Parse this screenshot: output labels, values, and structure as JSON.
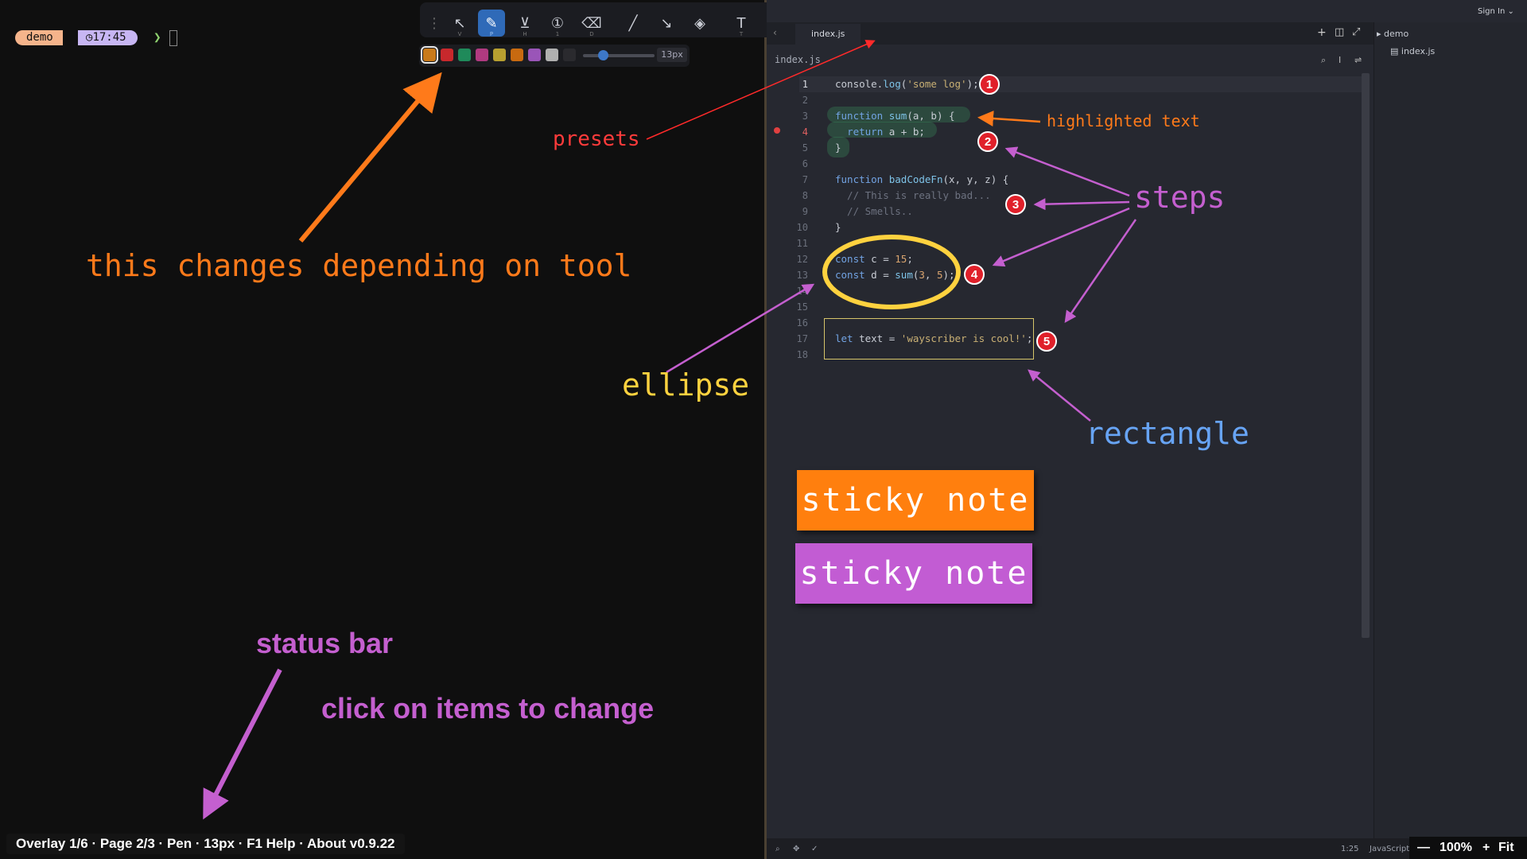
{
  "terminal": {
    "session_name": "demo",
    "clock": "17:45",
    "prompt_symbol": "❯"
  },
  "toolbar": {
    "tools": [
      {
        "name": "select-tool",
        "icon": "cursor-icon",
        "key": "V"
      },
      {
        "name": "pen-tool",
        "icon": "pen-icon",
        "key": "P",
        "active": true
      },
      {
        "name": "marker-tool",
        "icon": "marker-icon",
        "key": "H"
      },
      {
        "name": "step-tool",
        "icon": "step-marker-icon",
        "key": "1"
      },
      {
        "name": "eraser-tool",
        "icon": "eraser-icon",
        "key": "D"
      },
      {
        "name": "line-tool",
        "icon": "line-icon",
        "key": ""
      },
      {
        "name": "arrow-tool",
        "icon": "arrow-icon",
        "key": ""
      },
      {
        "name": "shapes-tool",
        "icon": "shapes-icon",
        "key": ""
      },
      {
        "name": "text-tool",
        "icon": "text-icon",
        "key": "T"
      }
    ],
    "preset_number": "5",
    "size_readout": "13px"
  },
  "color_presets": [
    "#c87a1a",
    "#c8282c",
    "#1f8a5a",
    "#b03a80",
    "#b8a030",
    "#c86a10",
    "#9a55b8",
    "#b0b0b0",
    "#2a2a2e"
  ],
  "editor": {
    "sign_in": "Sign In",
    "tab_label": "index.js",
    "breadcrumb": "index.js",
    "explorer_folder": "demo",
    "explorer_file": "index.js",
    "line_numbers": [
      "1",
      "2",
      "3",
      "4",
      "5",
      "6",
      "7",
      "8",
      "9",
      "10",
      "11",
      "12",
      "13",
      "14",
      "15",
      "16",
      "17",
      "18"
    ],
    "status_position": "1:25",
    "status_language": "JavaScript"
  },
  "annotations": {
    "presets": "presets",
    "highlighted_text": "highlighted text",
    "tool_changes": "this changes depending on tool",
    "steps": "steps",
    "ellipse": "ellipse",
    "rectangle": "rectangle",
    "sticky_note_1": "sticky note",
    "sticky_note_2": "sticky note",
    "status_bar": "status bar",
    "click_items": "click on items to change",
    "step_numbers": [
      "1",
      "2",
      "3",
      "4",
      "5"
    ]
  },
  "status_bar": {
    "text": "Overlay 1/6 · Page 2/3 · Pen · 13px · F1 Help · About v0.9.22"
  },
  "zoom": {
    "level": "100%",
    "fit": "Fit"
  },
  "colors": {
    "orange_annotation": "#ff7a1a",
    "red_annotation": "#ff3b3b",
    "purple_annotation": "#c45fcf",
    "yellow_annotation": "#ffd23f",
    "blue_annotation": "#67a4f5",
    "sticky_orange": "#ff7f0e",
    "sticky_purple": "#c25cd3"
  }
}
